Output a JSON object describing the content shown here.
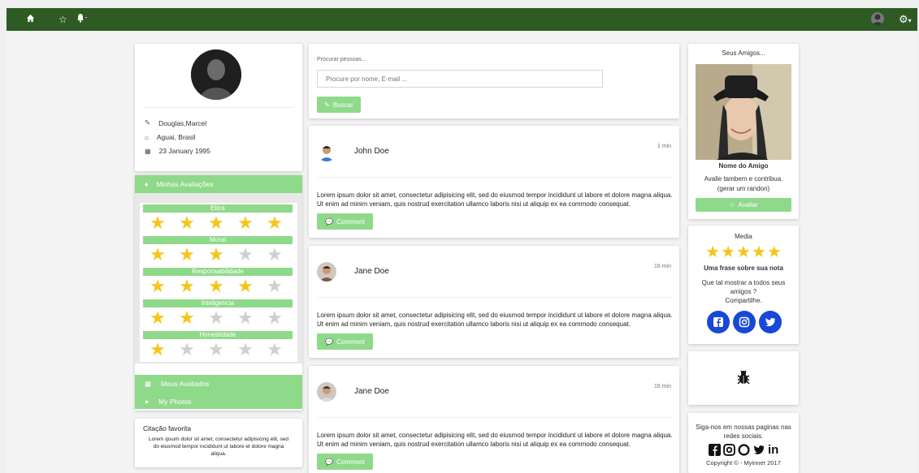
{
  "nav": {
    "home_icon": "home-icon",
    "star_icon": "star-icon",
    "bell_icon": "bell-icon",
    "settings_icon": "gear-icon"
  },
  "profile": {
    "name": "Douglas,Marcel",
    "location": "Aguai, Brasil",
    "birthday": "23 January 1995"
  },
  "ratings": {
    "header": "Minhas Avaliações",
    "items": [
      {
        "label": "Etica",
        "stars": 5
      },
      {
        "label": "Moral",
        "stars": 3
      },
      {
        "label": "Responsabilidade",
        "stars": 4
      },
      {
        "label": "Inteligencia",
        "stars": 2
      },
      {
        "label": "Honestidade",
        "stars": 1
      }
    ],
    "links": [
      "Meus Avaliados",
      "My Photos"
    ]
  },
  "quote": {
    "title": "Citação favorita",
    "text": "Lorem ipsum dolor sit amet, consectetur adipisicing elit, sed do eiusmod tempor incididunt ut labore et dolore magna aliqua."
  },
  "search": {
    "label": "Procurar pessoas...",
    "placeholder": "Procure por nome, E-mail ...",
    "button": "Buscar"
  },
  "posts": [
    {
      "author": "John Doe",
      "time": "1 min",
      "text": "Lorem ipsum dolor sit amet, consectetur adipisicing elit, sed do eiusmod tempor incididunt ut labore et dolore magna aliqua. Ut enim ad minim veniam, quis nostrud exercitation ullamco laboris nisi ut aliquip ex ea commodo consequat.",
      "button": "Comment"
    },
    {
      "author": "Jane Doe",
      "time": "16 min",
      "text": "Lorem ipsum dolor sit amet, consectetur adipisicing elit, sed do eiusmod tempor incididunt ut labore et dolore magna aliqua. Ut enim ad minim veniam, quis nostrud exercitation ullamco laboris nisi ut aliquip ex ea commodo consequat.",
      "button": "Comment"
    },
    {
      "author": "Jane Doe",
      "time": "16 min",
      "text": "Lorem ipsum dolor sit amet, consectetur adipisicing elit, sed do eiusmod tempor incididunt ut labore et dolore magna aliqua. Ut enim ad minim veniam, quis nostrud exercitation ullamco laboris nisi ut aliquip ex ea commodo consequat.",
      "button": "Comment"
    }
  ],
  "friends": {
    "title": "Seus Amigos...",
    "name": "Nome do Amigo",
    "desc1": "Avalie tambem e contribua.",
    "desc2": "(gerar um randon)",
    "button": "Avaliar"
  },
  "media": {
    "title": "Media",
    "stars": 5,
    "phrase": "Uma frase sobre sua nota",
    "share1": "Que tal mostrar a todos seus",
    "share2": "amigos ?",
    "share3": "Compartilhe."
  },
  "follow": {
    "text1": "Siga-nos em nossas paginas nas",
    "text2": "redes sociais.",
    "copyright": "Copyright © - Myinner 2017"
  }
}
